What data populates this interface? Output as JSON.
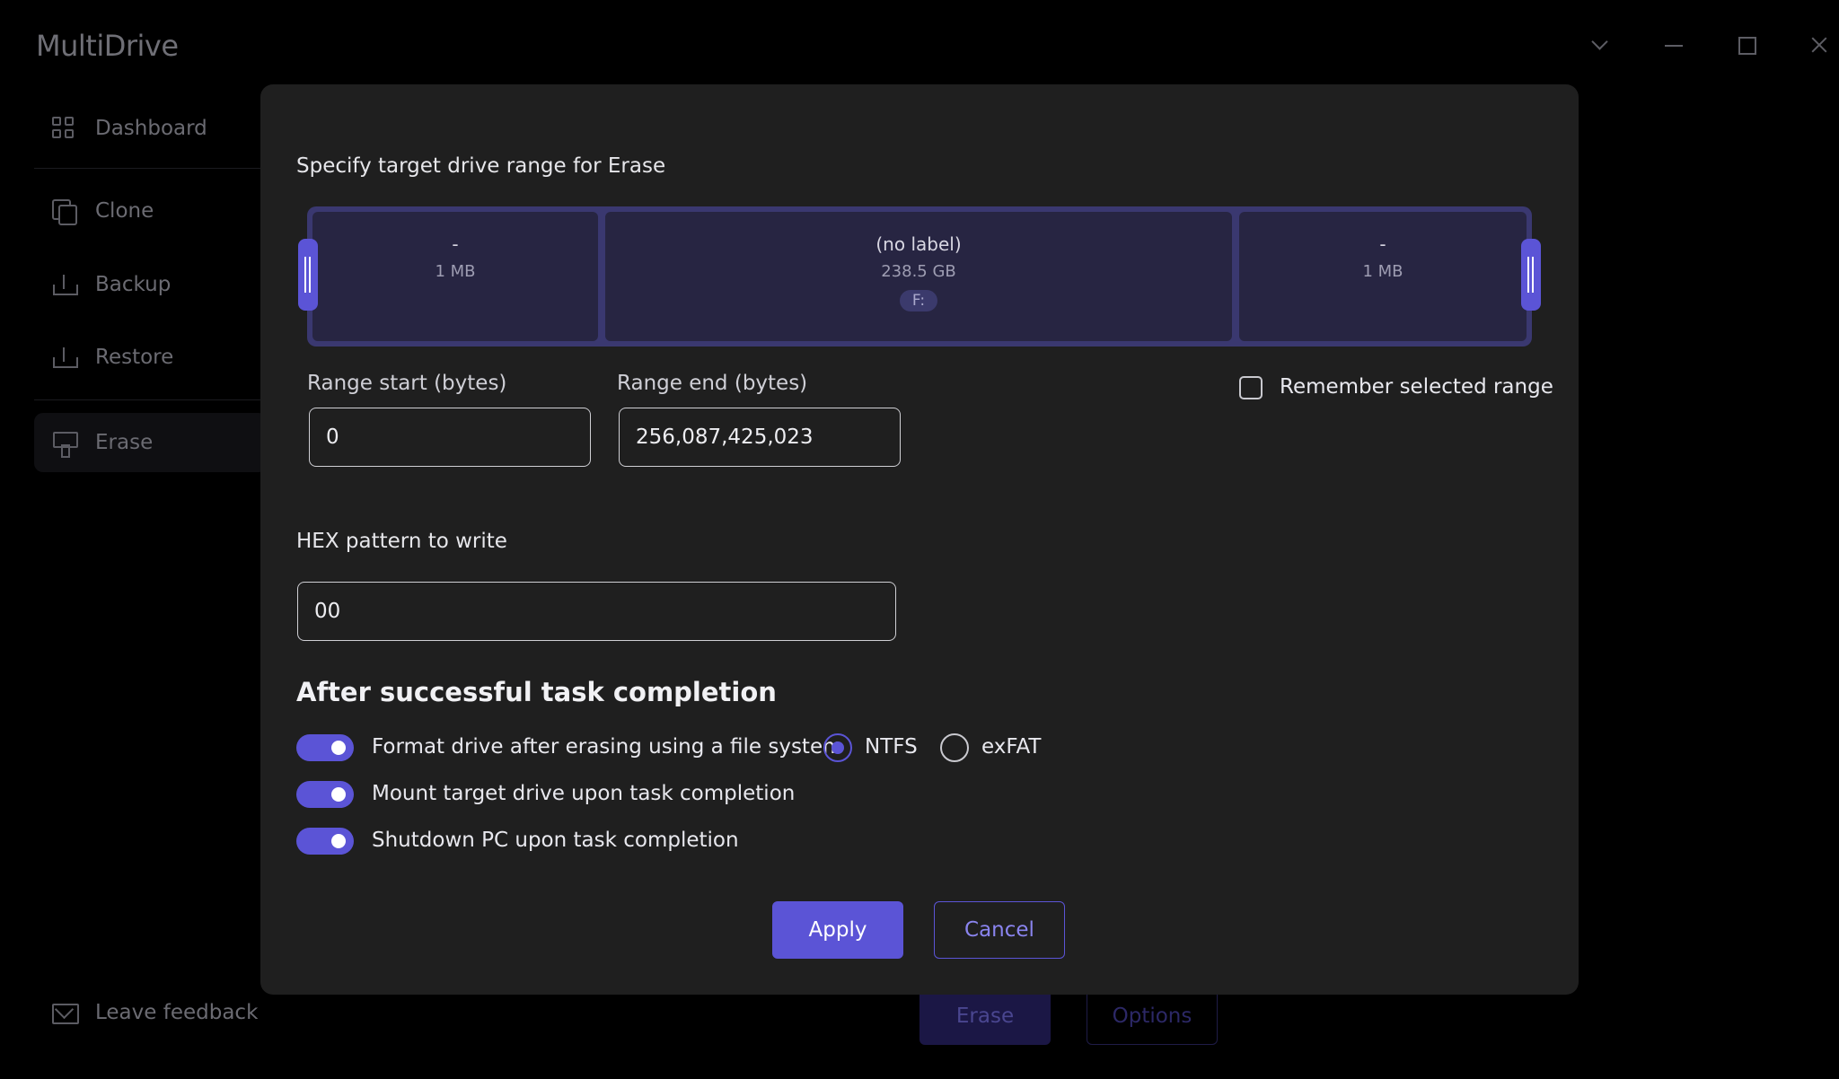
{
  "app": {
    "title": "MultiDrive"
  },
  "window_controls": {
    "dropdown_icon": "chevron-down-icon",
    "minimize_icon": "minimize-icon",
    "maximize_icon": "maximize-icon",
    "close_icon": "close-icon"
  },
  "sidebar": {
    "items": [
      {
        "label": "Dashboard",
        "icon": "dashboard-grid-icon"
      },
      {
        "label": "Clone",
        "icon": "clone-copy-icon"
      },
      {
        "label": "Backup",
        "icon": "backup-upload-icon"
      },
      {
        "label": "Restore",
        "icon": "restore-download-icon"
      },
      {
        "label": "Erase",
        "icon": "erase-brush-icon",
        "active": true
      }
    ],
    "feedback": {
      "label": "Leave feedback",
      "icon": "mail-icon"
    }
  },
  "background_actions": {
    "erase_label": "Erase",
    "options_label": "Options"
  },
  "dialog": {
    "range_title": "Specify target drive range for Erase",
    "partitions": [
      {
        "label": "-",
        "size": "1 MB"
      },
      {
        "label": "(no label)",
        "size": "238.5 GB",
        "letter": "F:"
      },
      {
        "label": "-",
        "size": "1 MB"
      }
    ],
    "range_start": {
      "label": "Range start (bytes)",
      "value": "0"
    },
    "range_end": {
      "label": "Range end (bytes)",
      "value": "256,087,425,023"
    },
    "remember_range": {
      "label": "Remember selected range",
      "checked": false
    },
    "hex_pattern": {
      "label": "HEX pattern to write",
      "value": "00"
    },
    "after_completion": {
      "title": "After successful task completion",
      "format_drive": {
        "label": "Format drive after erasing using a file system",
        "enabled": true
      },
      "filesystems": [
        {
          "label": "NTFS",
          "selected": true
        },
        {
          "label": "exFAT",
          "selected": false
        }
      ],
      "mount_drive": {
        "label": "Mount target drive upon task completion",
        "enabled": true
      },
      "shutdown_pc": {
        "label": "Shutdown PC upon task completion",
        "enabled": true
      }
    },
    "apply_label": "Apply",
    "cancel_label": "Cancel"
  },
  "colors": {
    "accent": "#5b54d6",
    "dialog_background": "#1f1f1f",
    "page_background": "#000000"
  }
}
